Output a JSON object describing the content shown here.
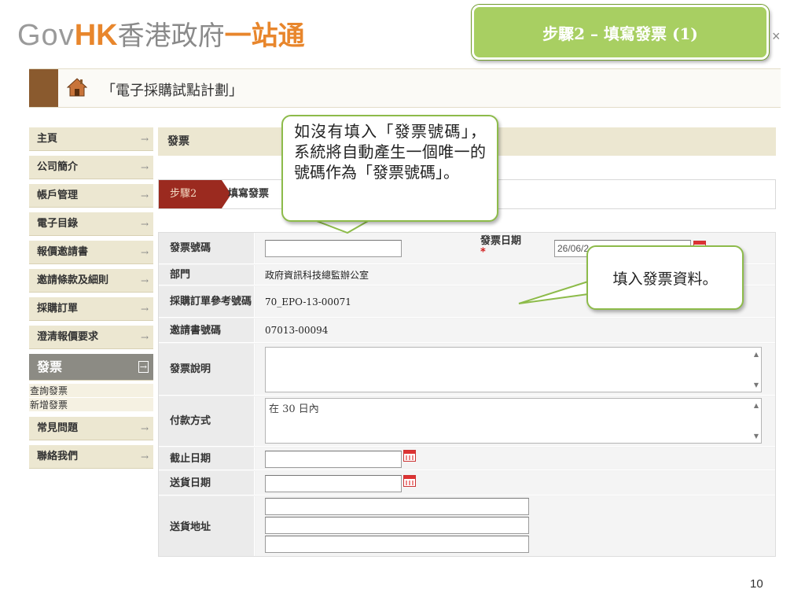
{
  "header": {
    "logo_gov": "Gov",
    "logo_hk": "HK",
    "logo_chinese": "香港政府",
    "logo_accent": "一站通",
    "close_glyph": "×"
  },
  "step_banner": "步驟2 – 填寫發票 (1)",
  "title_bar": {
    "icon": "house-icon",
    "page_title": "「電子採購試點計劃」"
  },
  "sidebar": {
    "items": [
      {
        "label": "主頁",
        "arrow": "→"
      },
      {
        "label": "公司簡介",
        "arrow": "→"
      },
      {
        "label": "帳戶管理",
        "arrow": "→"
      },
      {
        "label": "電子目錄",
        "arrow": "→"
      },
      {
        "label": "報價邀請書",
        "arrow": "→"
      },
      {
        "label": "邀請條款及細則",
        "arrow": "→"
      },
      {
        "label": "採購訂單",
        "arrow": "→"
      },
      {
        "label": "澄清報價要求",
        "arrow": "→"
      }
    ],
    "active": {
      "label": "發票",
      "arrow": "→"
    },
    "sub_items": [
      {
        "label": "查詢發票"
      },
      {
        "label": "新增發票"
      }
    ],
    "items_after": [
      {
        "label": "常見問題",
        "arrow": "→"
      },
      {
        "label": "聯絡我們",
        "arrow": "→"
      }
    ]
  },
  "main": {
    "heading": "發票",
    "step_tag": "步驟2",
    "step_text": "填寫發票"
  },
  "form": {
    "invoice_no_label": "發票號碼",
    "invoice_no_value": "",
    "invoice_date_label": "發票日期",
    "required_mark": "*",
    "invoice_date_value": "26/06/2",
    "department_label": "部門",
    "department_value": "政府資訊科技總監辦公室",
    "po_ref_label": "採購訂單參考號碼",
    "po_ref_value": "70_EPO-13-00071",
    "invitation_no_label": "邀請書號碼",
    "invitation_no_value": "07013-00094",
    "description_label": "發票說明",
    "description_value": "",
    "payment_label": "付款方式",
    "payment_value": "在 30 日內",
    "deadline_label": "截止日期",
    "deadline_value": "",
    "delivery_date_label": "送貨日期",
    "delivery_date_value": "",
    "address_label": "送貨地址",
    "address_lines": [
      "",
      "",
      ""
    ]
  },
  "callouts": {
    "auto_number": "如沒有填入「發票號碼」，系統將自動產生一個唯一的號碼作為「發票號碼」。",
    "fill_info": "填入發票資料。"
  },
  "page_number": "10",
  "colors": {
    "banner_green": "#a8cf62",
    "callout_border": "#8dbb4a",
    "step_tag_red": "#9b2a1f",
    "nav_beige": "#ece7d1",
    "logo_orange": "#e8862c"
  }
}
